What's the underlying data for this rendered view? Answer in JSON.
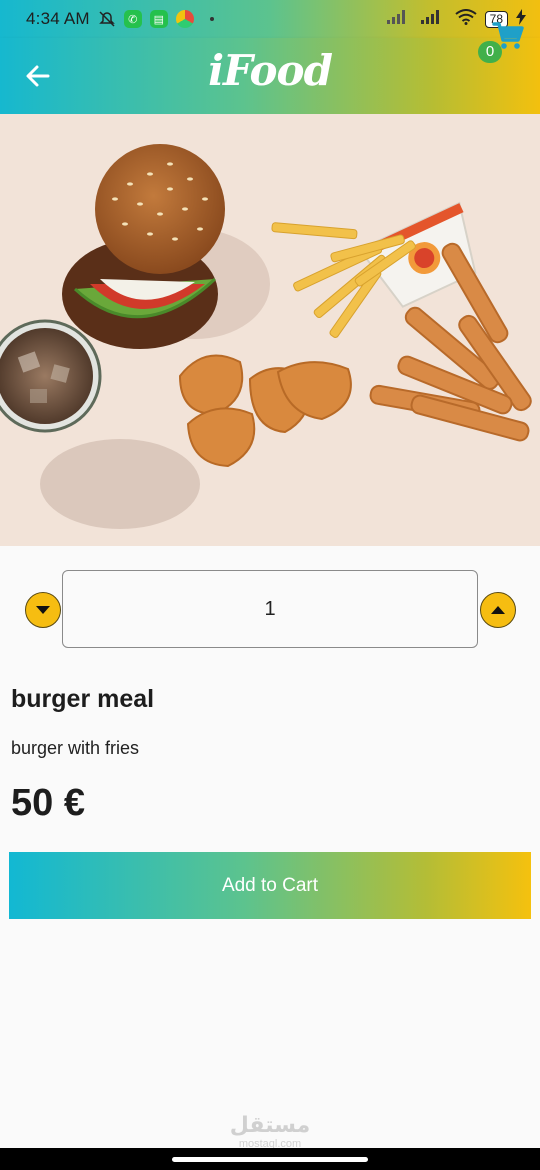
{
  "status_bar": {
    "time": "4:34 AM",
    "battery": "78"
  },
  "app_bar": {
    "title": "iFood",
    "cart_count": "0",
    "back_icon": "arrow-left-icon",
    "cart_icon": "shopping-cart-icon"
  },
  "product": {
    "quantity": "1",
    "name": "burger meal",
    "description": "burger with fries",
    "price": "50 €",
    "add_to_cart_label": "Add to Cart"
  },
  "watermark": {
    "arabic": "مستقل",
    "latin": "mostaql.com"
  },
  "colors": {
    "gradient_start": "#16b8cf",
    "gradient_mid": "#5cc38e",
    "gradient_end": "#f3c00e",
    "accent_yellow": "#f6bd11",
    "badge_green": "#41b04a"
  }
}
